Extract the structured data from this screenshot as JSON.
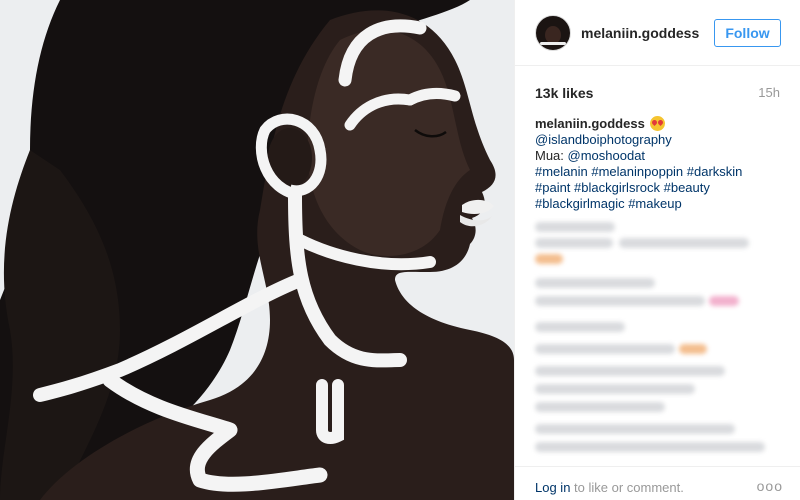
{
  "post": {
    "username": "melaniin.goddess",
    "follow_label": "Follow",
    "likes": "13k likes",
    "time": "15h"
  },
  "caption": {
    "username": "melaniin.goddess",
    "emoji": "heart-eyes-emoji",
    "photographer": "@islandboiphotography",
    "mua_prefix": "Mua: ",
    "mua_handle": "@moshoodat",
    "hashtags_line1": "#melanin #melaninpoppin #darkskin",
    "hashtags_line2": "#paint #blackgirlsrock #beauty",
    "hashtags_line3": "#blackgirlmagic #makeup"
  },
  "footer": {
    "login_link": "Log in",
    "login_suffix": " to like or comment.",
    "more_label": "ooo"
  },
  "colors": {
    "link": "#003569",
    "follow": "#3897f0",
    "muted": "#999999"
  }
}
